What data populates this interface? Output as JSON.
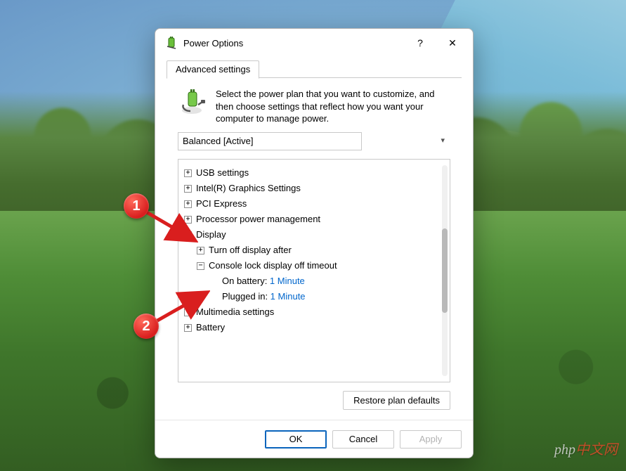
{
  "dialog": {
    "title": "Power Options",
    "help_label": "?",
    "close_label": "✕",
    "tab_label": "Advanced settings",
    "intro_text": "Select the power plan that you want to customize, and then choose settings that reflect how you want your computer to manage power.",
    "plan_selected": "Balanced [Active]",
    "restore_label": "Restore plan defaults",
    "ok_label": "OK",
    "cancel_label": "Cancel",
    "apply_label": "Apply"
  },
  "tree": {
    "usb": "USB settings",
    "intel": "Intel(R) Graphics Settings",
    "pci": "PCI Express",
    "proc": "Processor power management",
    "display": "Display",
    "turn_off": "Turn off display after",
    "console_lock": "Console lock display off timeout",
    "on_battery_label": "On battery: ",
    "on_battery_value": "1 Minute",
    "plugged_in_label": "Plugged in: ",
    "plugged_in_value": "1 Minute",
    "multimedia": "Multimedia settings",
    "battery": "Battery"
  },
  "annotations": {
    "one": "1",
    "two": "2"
  },
  "watermark": {
    "p1": "php",
    "p2": "中文网"
  }
}
